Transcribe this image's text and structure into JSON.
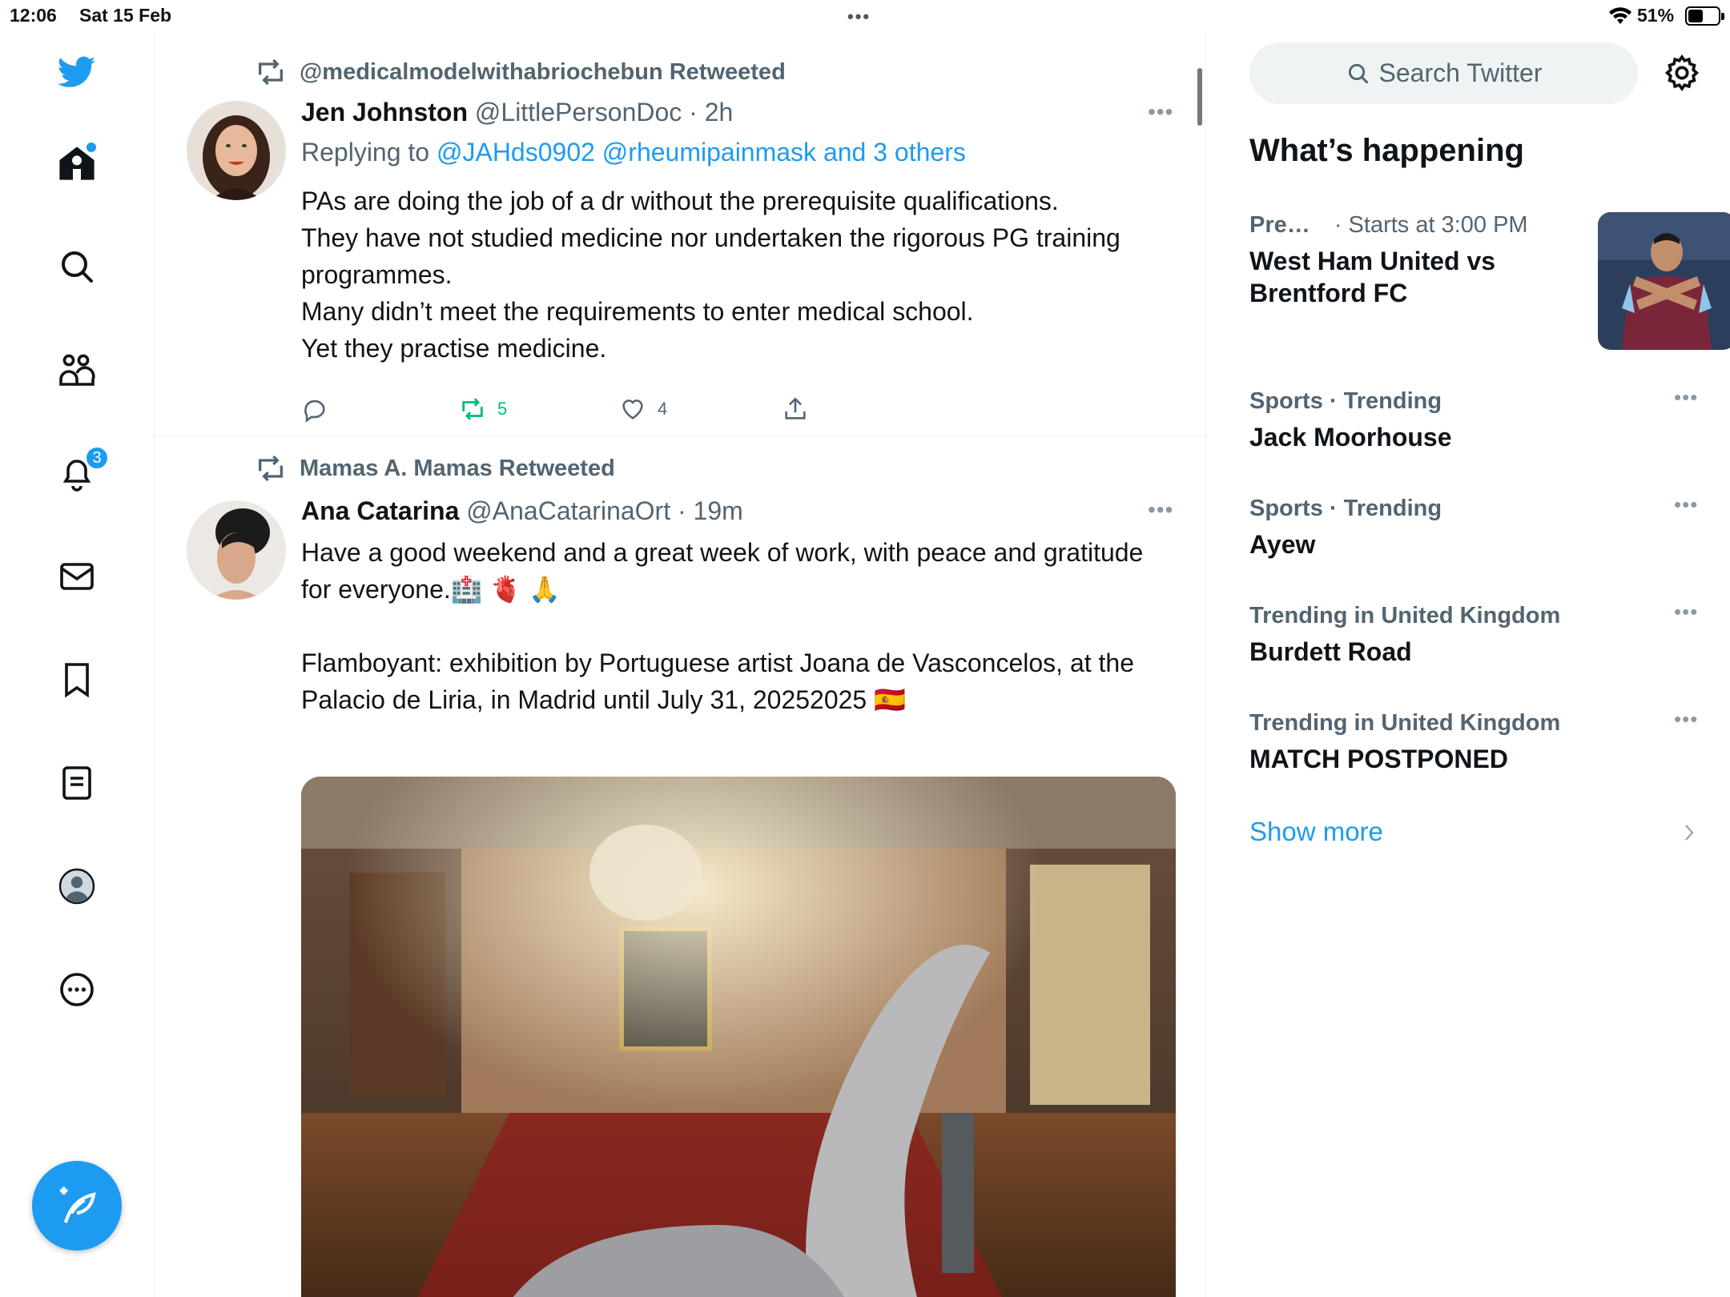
{
  "status_bar": {
    "time": "12:06",
    "date": "Sat 15 Feb",
    "battery": "51%",
    "battery_level": 0.51
  },
  "nav": {
    "notifications_badge": "3",
    "accent_color": "#1d9bf0"
  },
  "tweets": [
    {
      "retweeted_by": "@medicalmodelwithabriochebun Retweeted",
      "name": "Jen Johnston",
      "handle": "@LittlePersonDoc",
      "time": "· 2h",
      "reply_prefix": "Replying to ",
      "reply_targets": "@JAHds0902 @rheumipainmask and 3 others",
      "text_lines": [
        "PAs are doing the job of a dr without the prerequisite qualifications.",
        "They have not studied medicine nor undertaken the rigorous PG training programmes.",
        "Many didn’t meet the requirements to enter medical school.",
        "Yet they practise medicine."
      ],
      "retweets": "5",
      "likes": "4"
    },
    {
      "retweeted_by": "Mamas A. Mamas Retweeted",
      "name": "Ana Catarina",
      "handle": "@AnaCatarinaOrt",
      "time": "· 19m",
      "text_p1": "Have a good weekend and a great week of work, with peace and gratitude for everyone.🏥 🫀 🙏",
      "text_p2": "Flamboyant: exhibition by Portuguese artist Joana de Vasconcelos, at the Palacio de Liria, in Madrid until July 31, 20252025 🇪🇸"
    }
  ],
  "sidebar": {
    "search_placeholder": "Search Twitter",
    "title": "What’s happening",
    "event": {
      "category": "Pre…",
      "time": "· Starts at 3:00 PM",
      "topic": "West Ham United vs Brentford FC"
    },
    "trends": [
      {
        "meta": "Sports · Trending",
        "topic": "Jack Moorhouse"
      },
      {
        "meta": "Sports · Trending",
        "topic": "Ayew"
      },
      {
        "meta": "Trending in United Kingdom",
        "topic": "Burdett Road"
      },
      {
        "meta": "Trending in United Kingdom",
        "topic": "MATCH POSTPONED"
      }
    ],
    "show_more": "Show more"
  }
}
